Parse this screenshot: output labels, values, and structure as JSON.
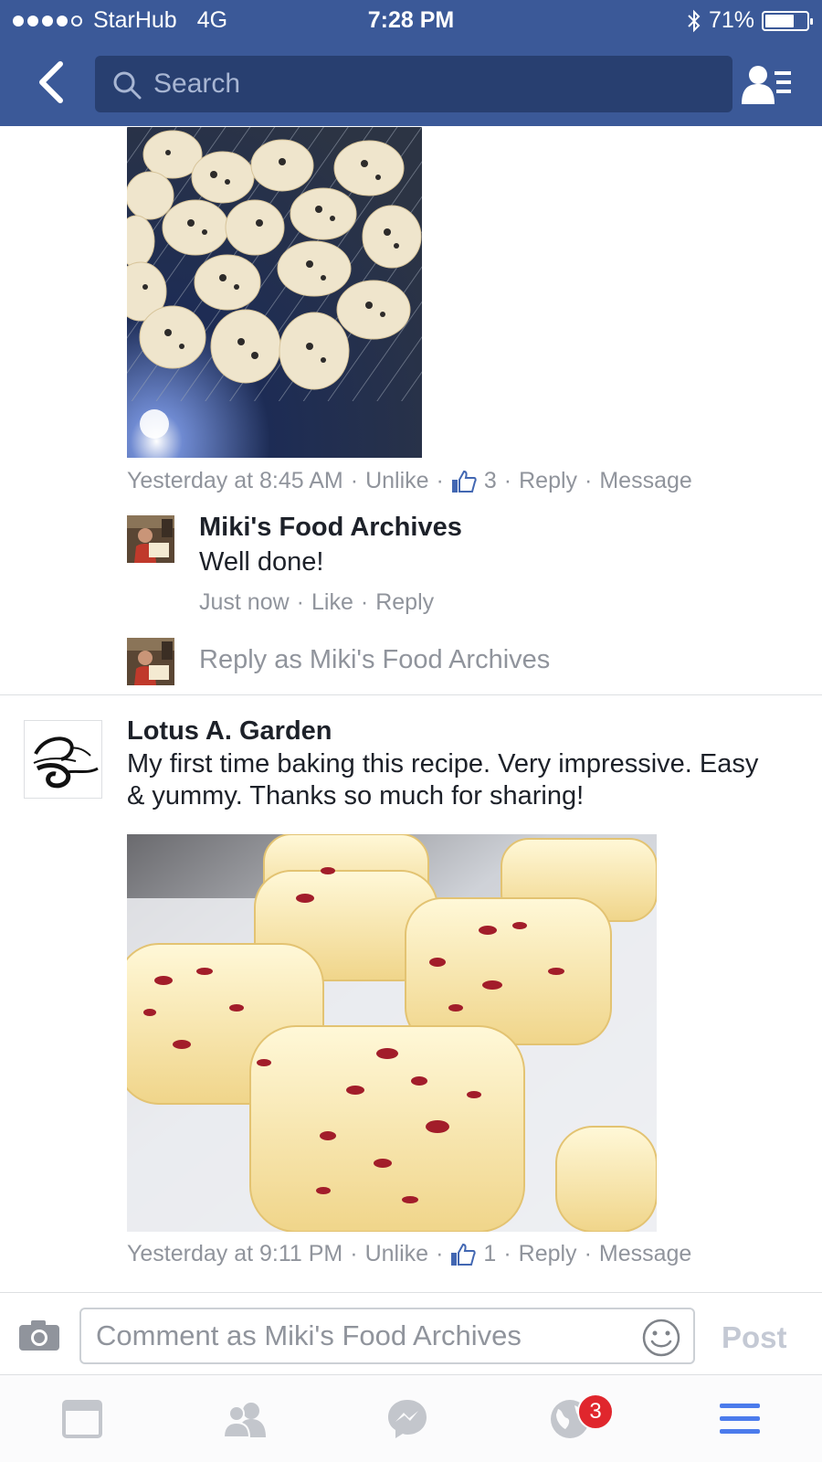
{
  "status_bar": {
    "carrier": "StarHub",
    "network": "4G",
    "time": "7:28 PM",
    "battery_percent": "71%",
    "battery_level": 0.71,
    "signal_bars_filled": 4,
    "signal_bars_total": 5
  },
  "header": {
    "search_placeholder": "Search",
    "icons": {
      "back": "chevron-left-icon",
      "search": "search-icon",
      "friends": "friend-requests-icon"
    }
  },
  "comments": [
    {
      "meta": {
        "timestamp": "Yesterday at 8:45 AM",
        "unlike": "Unlike",
        "like_count": "3",
        "reply": "Reply",
        "message": "Message"
      },
      "replies": [
        {
          "author": "Miki's Food Archives",
          "text": "Well done!",
          "timestamp": "Just now",
          "like": "Like",
          "reply": "Reply"
        }
      ],
      "reply_as": "Reply as Miki's Food Archives"
    },
    {
      "author": "Lotus A. Garden",
      "text": "My first time baking this recipe. Very impressive. Easy & yummy. Thanks so much for sharing!",
      "meta": {
        "timestamp": "Yesterday at 9:11 PM",
        "unlike": "Unlike",
        "like_count": "1",
        "reply": "Reply",
        "message": "Message"
      }
    }
  ],
  "composer": {
    "placeholder": "Comment as Miki's Food Archives",
    "post_label": "Post"
  },
  "tabbar": {
    "tabs": [
      {
        "icon": "news-feed-icon"
      },
      {
        "icon": "friends-icon"
      },
      {
        "icon": "messenger-icon"
      },
      {
        "icon": "notifications-globe-icon",
        "badge": "3"
      },
      {
        "icon": "menu-icon"
      }
    ]
  },
  "colors": {
    "brand_blue": "#3b5998",
    "search_bg": "#283f70",
    "meta_gray": "#90949c",
    "badge_red": "#e0262d",
    "tab_gray": "#c3c6cc",
    "tab_active": "#4b7bec"
  }
}
